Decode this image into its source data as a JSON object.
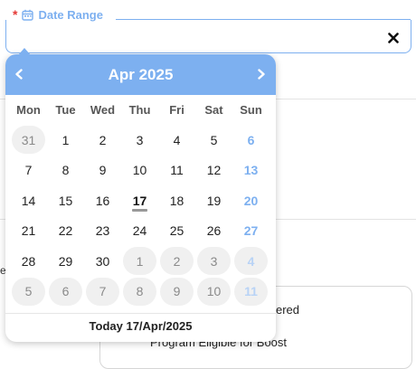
{
  "field": {
    "required_mark": "*",
    "label": "Date Range",
    "value": ""
  },
  "calendar": {
    "title": "Apr 2025",
    "weekdays": [
      "Mon",
      "Tue",
      "Wed",
      "Thu",
      "Fri",
      "Sat",
      "Sun"
    ],
    "days": [
      {
        "label": "31",
        "other": true,
        "sun": false,
        "today": false
      },
      {
        "label": "1",
        "other": false,
        "sun": false,
        "today": false
      },
      {
        "label": "2",
        "other": false,
        "sun": false,
        "today": false
      },
      {
        "label": "3",
        "other": false,
        "sun": false,
        "today": false
      },
      {
        "label": "4",
        "other": false,
        "sun": false,
        "today": false
      },
      {
        "label": "5",
        "other": false,
        "sun": false,
        "today": false
      },
      {
        "label": "6",
        "other": false,
        "sun": true,
        "today": false
      },
      {
        "label": "7",
        "other": false,
        "sun": false,
        "today": false
      },
      {
        "label": "8",
        "other": false,
        "sun": false,
        "today": false
      },
      {
        "label": "9",
        "other": false,
        "sun": false,
        "today": false
      },
      {
        "label": "10",
        "other": false,
        "sun": false,
        "today": false
      },
      {
        "label": "11",
        "other": false,
        "sun": false,
        "today": false
      },
      {
        "label": "12",
        "other": false,
        "sun": false,
        "today": false
      },
      {
        "label": "13",
        "other": false,
        "sun": true,
        "today": false
      },
      {
        "label": "14",
        "other": false,
        "sun": false,
        "today": false
      },
      {
        "label": "15",
        "other": false,
        "sun": false,
        "today": false
      },
      {
        "label": "16",
        "other": false,
        "sun": false,
        "today": false
      },
      {
        "label": "17",
        "other": false,
        "sun": false,
        "today": true
      },
      {
        "label": "18",
        "other": false,
        "sun": false,
        "today": false
      },
      {
        "label": "19",
        "other": false,
        "sun": false,
        "today": false
      },
      {
        "label": "20",
        "other": false,
        "sun": true,
        "today": false
      },
      {
        "label": "21",
        "other": false,
        "sun": false,
        "today": false
      },
      {
        "label": "22",
        "other": false,
        "sun": false,
        "today": false
      },
      {
        "label": "23",
        "other": false,
        "sun": false,
        "today": false
      },
      {
        "label": "24",
        "other": false,
        "sun": false,
        "today": false
      },
      {
        "label": "25",
        "other": false,
        "sun": false,
        "today": false
      },
      {
        "label": "26",
        "other": false,
        "sun": false,
        "today": false
      },
      {
        "label": "27",
        "other": false,
        "sun": true,
        "today": false
      },
      {
        "label": "28",
        "other": false,
        "sun": false,
        "today": false
      },
      {
        "label": "29",
        "other": false,
        "sun": false,
        "today": false
      },
      {
        "label": "30",
        "other": false,
        "sun": false,
        "today": false
      },
      {
        "label": "1",
        "other": true,
        "sun": false,
        "today": false
      },
      {
        "label": "2",
        "other": true,
        "sun": false,
        "today": false
      },
      {
        "label": "3",
        "other": true,
        "sun": false,
        "today": false
      },
      {
        "label": "4",
        "other": true,
        "sun": true,
        "today": false
      },
      {
        "label": "5",
        "other": true,
        "sun": false,
        "today": false
      },
      {
        "label": "6",
        "other": true,
        "sun": false,
        "today": false
      },
      {
        "label": "7",
        "other": true,
        "sun": false,
        "today": false
      },
      {
        "label": "8",
        "other": true,
        "sun": false,
        "today": false
      },
      {
        "label": "9",
        "other": true,
        "sun": false,
        "today": false
      },
      {
        "label": "10",
        "other": true,
        "sun": false,
        "today": false
      },
      {
        "label": "11",
        "other": true,
        "sun": true,
        "today": false
      }
    ],
    "footer": "Today 17/Apr/2025"
  },
  "background": {
    "card_text_1": "ered",
    "card_text_2": "Program Eligible for Boost",
    "edge_text": "e"
  },
  "colors": {
    "accent": "#7db0f0",
    "required": "#e53935",
    "other_month_bg": "#f0f0f0"
  },
  "icons": {
    "label_icon": "calendar-icon",
    "clear": "close-icon",
    "prev": "chevron-left-icon",
    "next": "chevron-right-icon"
  }
}
